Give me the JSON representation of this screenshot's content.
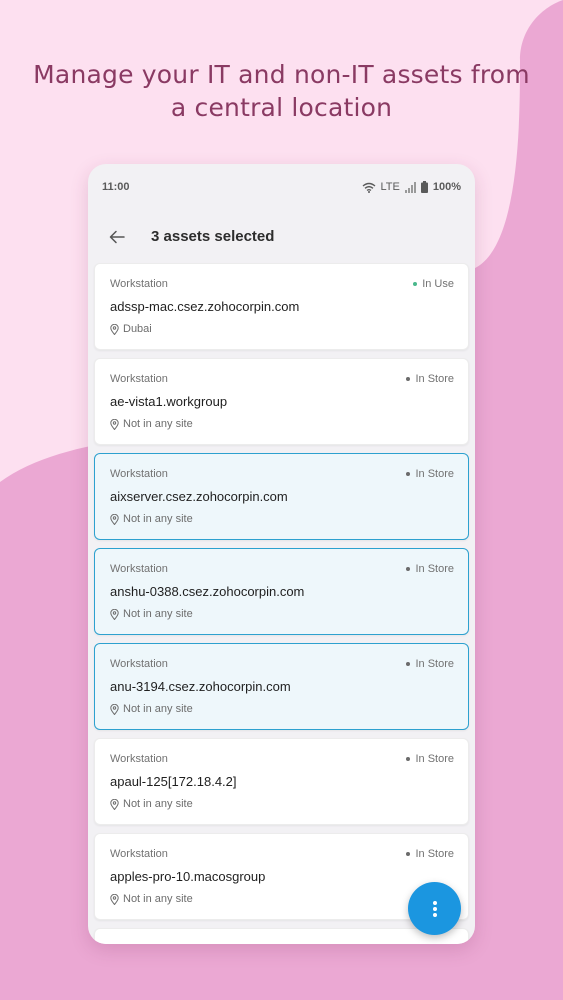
{
  "headline": {
    "line1": "Manage your IT and non-IT assets from",
    "line2": "a central location"
  },
  "status_bar": {
    "time": "11:00",
    "network": "LTE",
    "battery": "100%",
    "icons": [
      "wifi-icon",
      "signal-icon",
      "battery-icon"
    ]
  },
  "app_bar": {
    "back_icon": "arrow-left-icon",
    "title": "3 assets selected"
  },
  "assets": [
    {
      "type": "Workstation",
      "status": "In Use",
      "name": "adssp-mac.csez.zohocorpin.com",
      "location": "Dubai",
      "selected": false
    },
    {
      "type": "Workstation",
      "status": "In Store",
      "name": "ae-vista1.workgroup",
      "location": "Not in any site",
      "selected": false
    },
    {
      "type": "Workstation",
      "status": "In Store",
      "name": "aixserver.csez.zohocorpin.com",
      "location": "Not in any site",
      "selected": true
    },
    {
      "type": "Workstation",
      "status": "In Store",
      "name": "anshu-0388.csez.zohocorpin.com",
      "location": "Not in any site",
      "selected": true
    },
    {
      "type": "Workstation",
      "status": "In Store",
      "name": "anu-3194.csez.zohocorpin.com",
      "location": "Not in any site",
      "selected": true
    },
    {
      "type": "Workstation",
      "status": "In Store",
      "name": "apaul-125[172.18.4.2]",
      "location": "Not in any site",
      "selected": false
    },
    {
      "type": "Workstation",
      "status": "In Store",
      "name": "apples-pro-10.macosgroup",
      "location": "Not in any site",
      "selected": false
    }
  ],
  "fab": {
    "icon": "more-vertical-icon"
  },
  "colors": {
    "background": "#fde0f0",
    "blob": "#eba8d3",
    "headline": "#8a3a63",
    "selected_border": "#2da1cf",
    "selected_bg": "#eef7fb",
    "fab": "#1b96e0",
    "in_use_dot": "#49b88c"
  }
}
